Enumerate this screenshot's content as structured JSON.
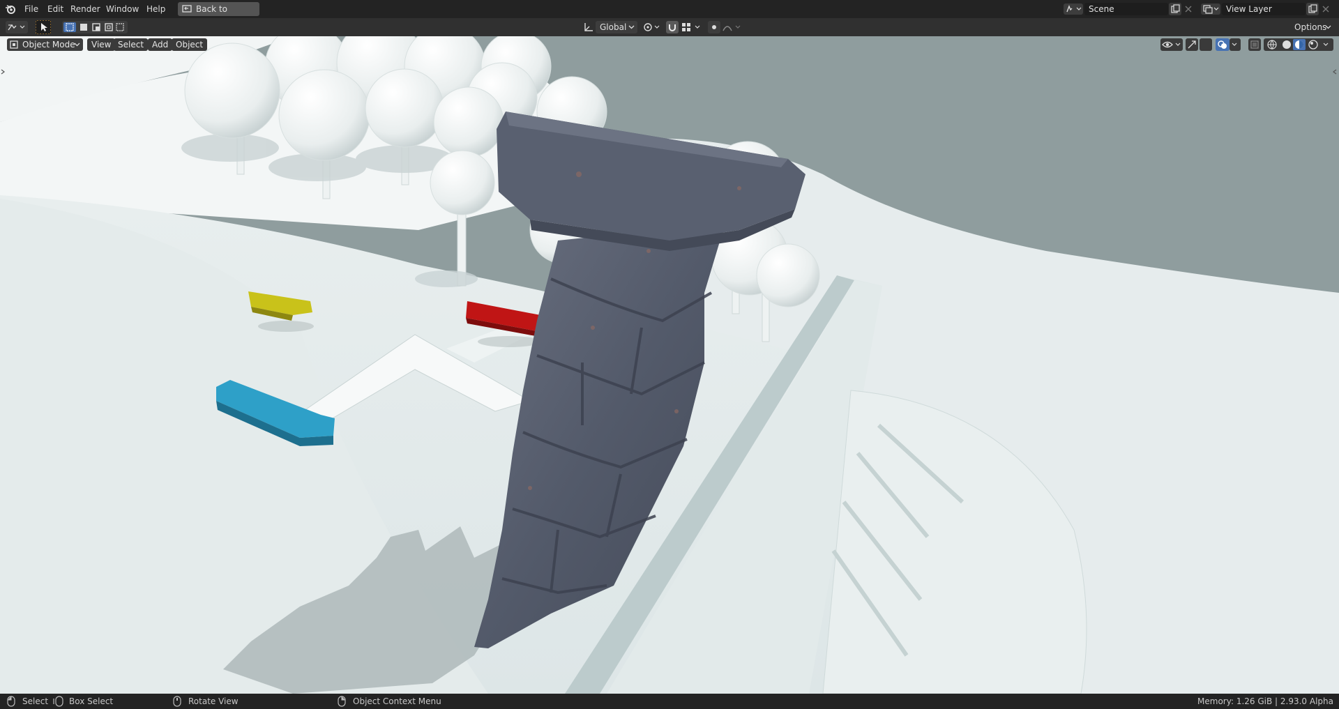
{
  "app": {
    "menu": [
      "File",
      "Edit",
      "Render",
      "Window",
      "Help"
    ],
    "back_button": "Back to Previous",
    "scene_name": "Scene",
    "view_layer_name": "View Layer"
  },
  "toolbar": {
    "transform_orientation": "Global",
    "options_label": "Options"
  },
  "viewport_header": {
    "mode": "Object Mode",
    "menus": [
      "View",
      "Select",
      "Add",
      "Object"
    ],
    "shading_mode": "material-preview"
  },
  "status": {
    "select": "Select",
    "box_select": "Box Select",
    "rotate_view": "Rotate View",
    "context_menu": "Object Context Menu",
    "info": "Memory: 1.26 GiB | 2.93.0 Alpha"
  },
  "colors": {
    "accent": "#4772b3",
    "yellow_object": "#c9c21a",
    "red_object": "#c01515",
    "blue_object": "#2ea0c8",
    "stone": "#5d6372"
  },
  "icons": [
    "blender-logo",
    "editor-type",
    "select-cursor",
    "select-box-modes",
    "screen-back",
    "scene-browse",
    "view-layer-browse",
    "transform-orientation",
    "pivot-point",
    "snap-magnet",
    "snap-target",
    "proportional-edit",
    "falloff",
    "object-mode",
    "visibility",
    "gizmo",
    "overlay",
    "xray",
    "wireframe-shading",
    "solid-shading",
    "material-shading",
    "rendered-shading",
    "mouse-left",
    "mouse-drag",
    "mouse-middle",
    "mouse-right"
  ]
}
